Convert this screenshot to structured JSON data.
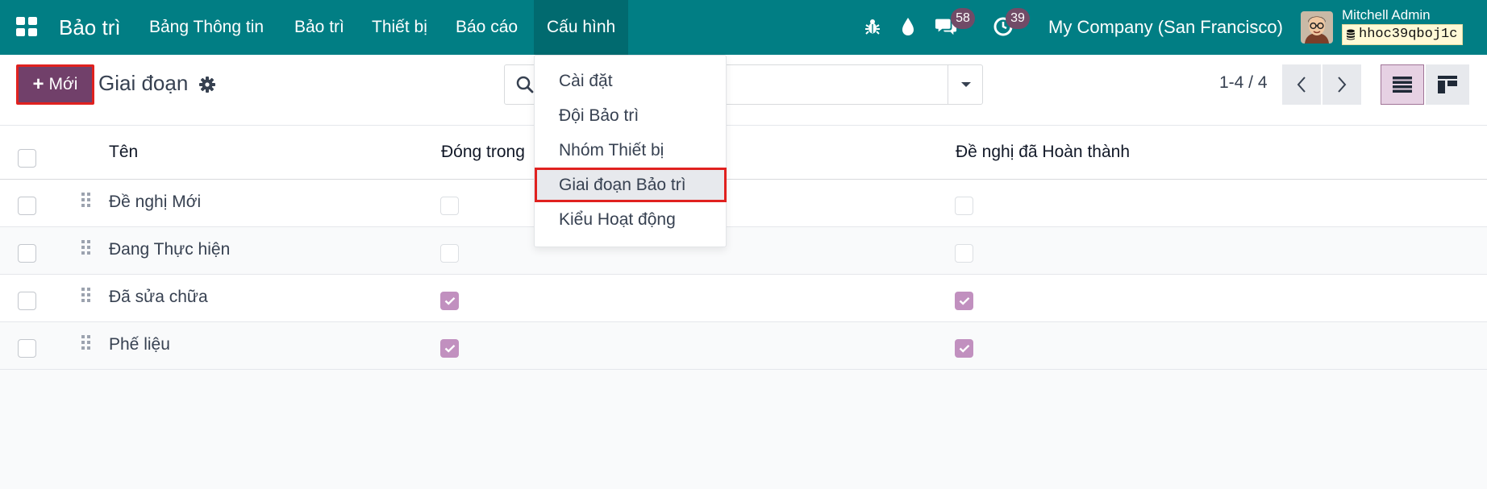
{
  "app": {
    "brand": "Bảo trì",
    "nav": [
      {
        "label": "Bảng Thông tin"
      },
      {
        "label": "Bảo trì"
      },
      {
        "label": "Thiết bị"
      },
      {
        "label": "Báo cáo"
      },
      {
        "label": "Cấu hình"
      }
    ],
    "active_nav": "Cấu hình",
    "messages_badge": "58",
    "activities_badge": "39",
    "company": "My Company (San Francisco)",
    "user_name": "Mitchell Admin",
    "database": "hhoc39qboj1c",
    "accent_color": "#017e84",
    "primary_color": "#71406a"
  },
  "control": {
    "new_label": "Mới",
    "title": "Giai đoạn",
    "search_placeholder": "",
    "pager": "1-4 / 4"
  },
  "table": {
    "columns": [
      "Tên",
      "Đóng trong",
      "Đề nghị đã Hoàn thành"
    ],
    "rows": [
      {
        "name": "Đề nghị Mới",
        "folded": false,
        "done": false
      },
      {
        "name": "Đang Thực hiện",
        "folded": false,
        "done": false
      },
      {
        "name": "Đã sửa chữa",
        "folded": true,
        "done": true
      },
      {
        "name": "Phế liệu",
        "folded": true,
        "done": true
      }
    ]
  },
  "menu": {
    "items": [
      {
        "label": "Cài đặt"
      },
      {
        "label": "Đội Bảo trì"
      },
      {
        "label": "Nhóm Thiết bị"
      },
      {
        "label": "Giai đoạn Bảo trì"
      },
      {
        "label": "Kiểu Hoạt động"
      }
    ],
    "highlighted": "Giai đoạn Bảo trì"
  }
}
